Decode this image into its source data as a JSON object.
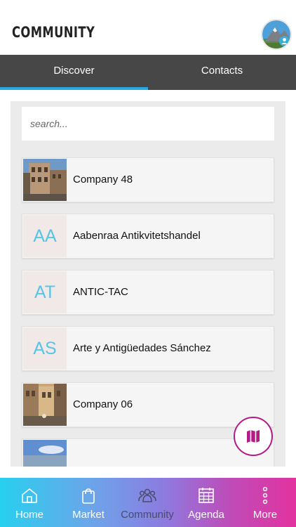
{
  "header": {
    "title": "COMMUNITY"
  },
  "tabs": [
    {
      "label": "Discover",
      "active": true
    },
    {
      "label": "Contacts",
      "active": false
    }
  ],
  "search": {
    "placeholder": "search..."
  },
  "items": [
    {
      "name": "Company 48",
      "initials": "",
      "thumb": "building-photo"
    },
    {
      "name": "Aabenraa Antikvitetshandel",
      "initials": "AA"
    },
    {
      "name": "ANTIC-TAC",
      "initials": "AT"
    },
    {
      "name": "Arte y Antigüedades Sánchez",
      "initials": "AS"
    },
    {
      "name": "Company 06",
      "initials": "",
      "thumb": "street-photo"
    },
    {
      "name": "",
      "initials": "",
      "thumb": "sky-photo"
    }
  ],
  "bottom_nav": [
    {
      "label": "Home",
      "icon": "home-icon"
    },
    {
      "label": "Market",
      "icon": "bag-icon"
    },
    {
      "label": "Community",
      "icon": "people-icon",
      "active": true
    },
    {
      "label": "Agenda",
      "icon": "calendar-icon"
    },
    {
      "label": "More",
      "icon": "more-icon"
    }
  ],
  "colors": {
    "tab_bg": "#474747",
    "accent": "#29a9e1",
    "fab_border": "#b31b86",
    "initials_text": "#58c4e6"
  }
}
